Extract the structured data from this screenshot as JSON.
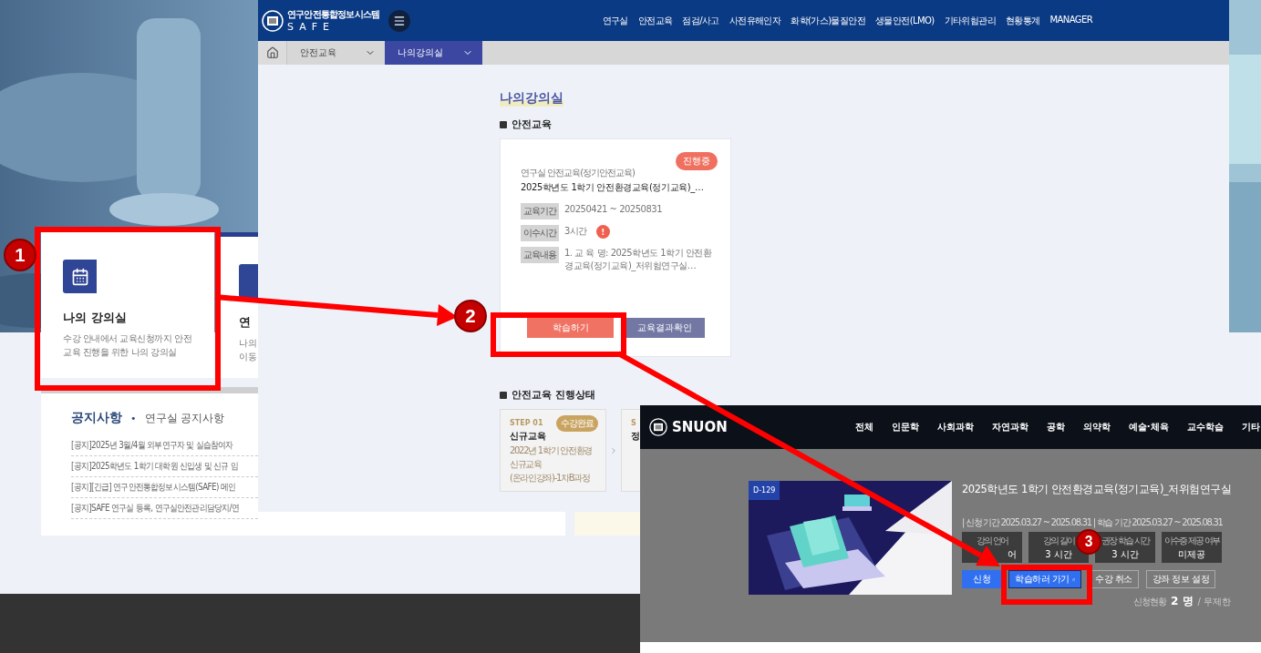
{
  "background_page": {
    "cards": [
      {
        "title": "나의 강의실",
        "description": [
          "수강 안내에서 교육신청까지 안전",
          "교육 진행을 위한 나의 강의실"
        ]
      },
      {
        "title": "연",
        "description": [
          "나의",
          "이동"
        ]
      }
    ],
    "notices": {
      "title": "공지사항",
      "separator": "•",
      "subtitle": "연구실 공지사항",
      "items": [
        "[공지]2025년 3월/4월 외부연구자 및 실습참여자",
        "[공지]2025학년도 1학기 대학원 신입생 및 신규 임",
        "[공지][긴급] 연구안전통합정보시스템(SAFE) 메인",
        "[공지]SAFE 연구실 등록, 연구실안전관리담당지/연"
      ]
    }
  },
  "safe_window": {
    "logo": {
      "name": "연구안전통합정보시스템",
      "wordmark": "SAFE"
    },
    "nav": [
      "연구실",
      "안전교육",
      "점검/사고",
      "사전유해인자",
      "화학(가스)물질안전",
      "생물안전(LMO)",
      "기타위험관리",
      "현황통계",
      "MANAGER"
    ],
    "breadcrumb": [
      {
        "label": "안전교육",
        "selected": false
      },
      {
        "label": "나의강의실",
        "selected": true
      }
    ],
    "page_title": "나의강의실",
    "section_title": "안전교육",
    "course_card": {
      "status": "진행중",
      "category": "연구실 안전교육(정기안전교육)",
      "title": "2025학년도 1학기 안전환경교육(정기교육)_…",
      "details": [
        {
          "label": "교육기간",
          "value": "20250421 ~ 20250831"
        },
        {
          "label": "이수시간",
          "value": "3시간",
          "alert": "!"
        },
        {
          "label": "교육내용",
          "value": "1. 교 육 명: 2025학년도 1학기 안전환경교육(정기교육)_저위험연구실…"
        }
      ],
      "buttons": [
        {
          "label": "학습하기",
          "kind": "primary"
        },
        {
          "label": "교육결과확인",
          "kind": "secondary"
        }
      ]
    },
    "progress_title": "안전교육 진행상태",
    "steps": [
      {
        "step": "STEP 01",
        "badge": "수강완료",
        "title": "신규교육",
        "description": [
          "2022년 1학기 안전환경",
          "신규교육",
          "(온라인강좌)-1차B과정"
        ]
      },
      {
        "step": "S",
        "title": "정"
      }
    ]
  },
  "snuon_window": {
    "logo": "SNUON",
    "nav": [
      "전체",
      "인문학",
      "사회과학",
      "자연과학",
      "공학",
      "의약학",
      "예술·체육",
      "교수학습",
      "기타"
    ],
    "badge": "D-129",
    "title": "2025학년도 1학기 안전환경교육(정기교육)_저위험연구실",
    "dates": "| 신청 기간 2025.03.27 ~ 2025.08.31 | 학습 기간 2025.03.27 ~ 2025.08.31",
    "info": [
      {
        "label": "강의 언어",
        "value": "어"
      },
      {
        "label": "강의 길이",
        "value": "3 시간"
      },
      {
        "label": "권장 학습 시간",
        "value": "3 시간"
      },
      {
        "label": "이수증 제공 여부",
        "value": "미제공"
      }
    ],
    "buttons": [
      {
        "label": "신청",
        "kind": "filled"
      },
      {
        "label": "학습하러 가기",
        "kind": "link"
      },
      {
        "label": "수강 취소",
        "kind": "outline"
      },
      {
        "label": "강좌 정보 설정",
        "kind": "outline"
      }
    ],
    "enrollment": {
      "label": "신청현황",
      "count": "2 명",
      "limit": "/ 무제한"
    }
  },
  "annotations": [
    {
      "label": "1"
    },
    {
      "label": "2"
    },
    {
      "label": "3"
    }
  ]
}
